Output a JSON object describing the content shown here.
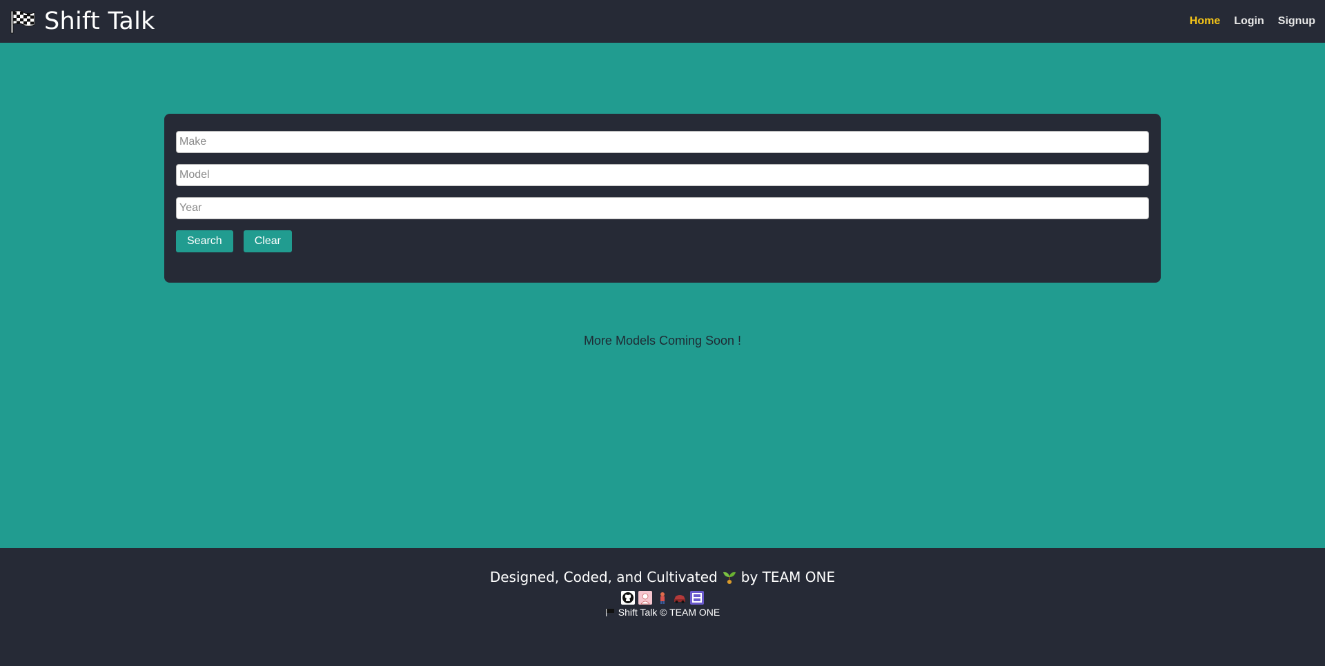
{
  "header": {
    "brand_icon": "checkered-flag-icon",
    "title": "Shift Talk",
    "nav": [
      {
        "label": "Home",
        "active": true
      },
      {
        "label": "Login",
        "active": false
      },
      {
        "label": "Signup",
        "active": false
      }
    ]
  },
  "search": {
    "make_placeholder": "Make",
    "model_placeholder": "Model",
    "year_placeholder": "Year",
    "make_value": "",
    "model_value": "",
    "year_value": "",
    "search_label": "Search",
    "clear_label": "Clear"
  },
  "main": {
    "coming_soon": "More Models Coming Soon !"
  },
  "footer": {
    "credit_prefix": "Designed, Coded, and Cultivated",
    "credit_icon": "seedling-icon",
    "credit_suffix": "by TEAM ONE",
    "avatars": [
      "github-avatar-icon",
      "portrait-avatar-icon",
      "person-avatar-icon",
      "car-avatar-icon",
      "robot-avatar-icon"
    ],
    "copyright_icon": "flag-icon",
    "copyright": "Shift Talk © TEAM ONE"
  },
  "colors": {
    "header_bg": "#262a36",
    "page_bg": "#219c90",
    "active_nav": "#f5c518",
    "button_bg": "#219c90"
  }
}
